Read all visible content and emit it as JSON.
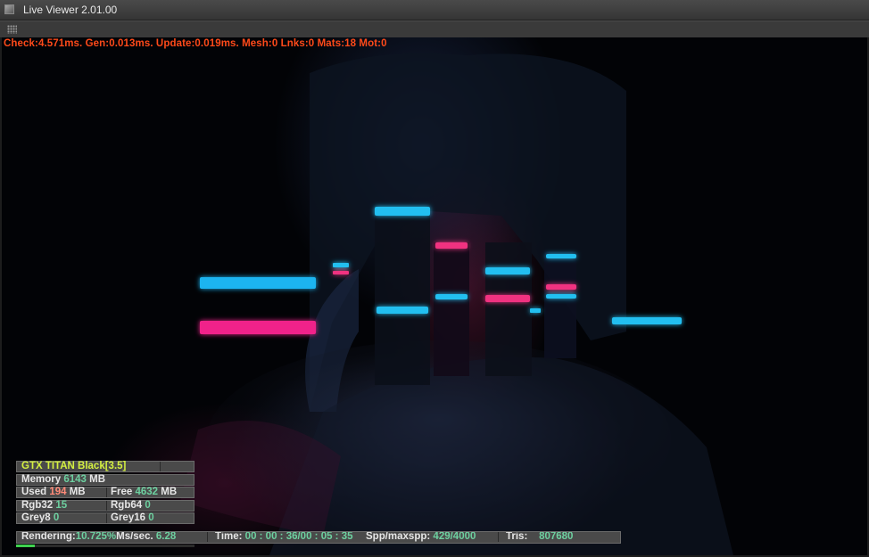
{
  "window": {
    "title": "Live Viewer 2.01.00"
  },
  "debug": {
    "text": "Check:4.571ms. Gen:0.013ms. Update:0.019ms. Mesh:0 Lnks:0 Mats:18 Mot:0"
  },
  "stats": {
    "gpu_name": "GTX TITAN Black[3.5]",
    "memory_label": "Memory",
    "memory_value": "6143",
    "memory_unit": "MB",
    "used_label": "Used",
    "used_value": "194",
    "used_unit": "MB",
    "free_label": "Free",
    "free_value": "4632",
    "free_unit": "MB",
    "rgb32_label": "Rgb32",
    "rgb32_value": "15",
    "rgb64_label": "Rgb64",
    "rgb64_value": "0",
    "grey8_label": "Grey8",
    "grey8_value": "0",
    "grey16_label": "Grey16",
    "grey16_value": "0"
  },
  "status": {
    "rendering_label": "Rendering:",
    "rendering_value": "10.725%",
    "ms_label": "Ms/sec.",
    "ms_value": "6.28",
    "time_label": "Time:",
    "time_value": "00 : 00 : 36/00 : 05 : 35",
    "spp_label": "Spp/maxspp:",
    "spp_value": "429/4000",
    "tris_label": "Tris:",
    "tris_value": "807680",
    "progress": 0.107
  },
  "colors": {
    "debug_text": "#ff4a1a",
    "value_text": "#6dd0a0",
    "gpu_text": "#d4f040",
    "progress": "#3fd14f"
  },
  "icons": {
    "window": "app-window-icon",
    "toolbar": "grip-icon"
  }
}
